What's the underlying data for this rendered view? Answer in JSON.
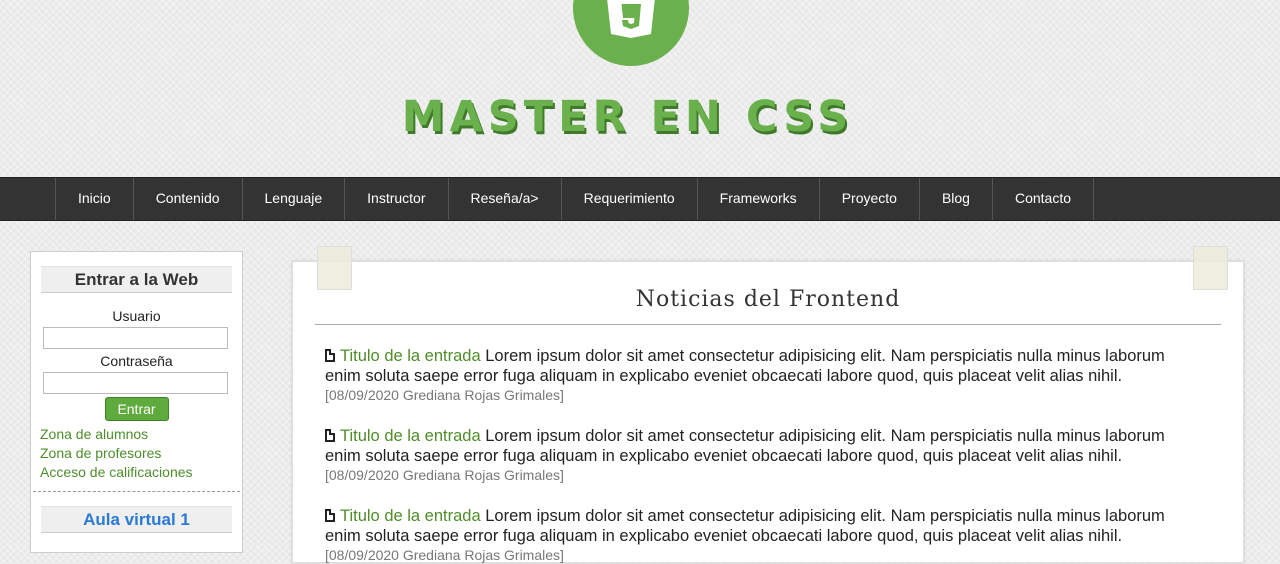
{
  "header": {
    "brand": "MASTER EN CSS",
    "logo_icon": "html5-shield-icon",
    "accent_color": "#6ab04c"
  },
  "nav": {
    "items": [
      "Inicio",
      "Contenido",
      "Lenguaje",
      "Instructor",
      "Reseña/a>",
      "Requerimiento",
      "Frameworks",
      "Proyecto",
      "Blog",
      "Contacto"
    ]
  },
  "sidebar": {
    "login_title": "Entrar a la Web",
    "user_label": "Usuario",
    "user_value": "",
    "pass_label": "Contraseña",
    "pass_value": "",
    "submit_label": "Entrar",
    "links": [
      "Zona de alumnos",
      "Zona de profesores",
      "Acceso de calificaciones"
    ],
    "aula_title": "Aula virtual 1"
  },
  "main": {
    "title": "Noticias del Frontend",
    "articles": [
      {
        "icon": "document-icon",
        "link": "Titulo de la entrada",
        "body": "Lorem ipsum dolor sit amet consectetur adipisicing elit. Nam perspiciatis nulla minus laborum enim soluta saepe error fuga aliquam in explicabo eveniet obcaecati labore quod, quis placeat velit alias nihil.",
        "meta": "[08/09/2020 Grediana Rojas Grimales]"
      },
      {
        "icon": "document-icon",
        "link": "Titulo de la entrada",
        "body": "Lorem ipsum dolor sit amet consectetur adipisicing elit. Nam perspiciatis nulla minus laborum enim soluta saepe error fuga aliquam in explicabo eveniet obcaecati labore quod, quis placeat velit alias nihil.",
        "meta": "[08/09/2020 Grediana Rojas Grimales]"
      },
      {
        "icon": "document-icon",
        "link": "Titulo de la entrada",
        "body": "Lorem ipsum dolor sit amet consectetur adipisicing elit. Nam perspiciatis nulla minus laborum enim soluta saepe error fuga aliquam in explicabo eveniet obcaecati labore quod, quis placeat velit alias nihil.",
        "meta": "[08/09/2020 Grediana Rojas Grimales]"
      }
    ]
  }
}
